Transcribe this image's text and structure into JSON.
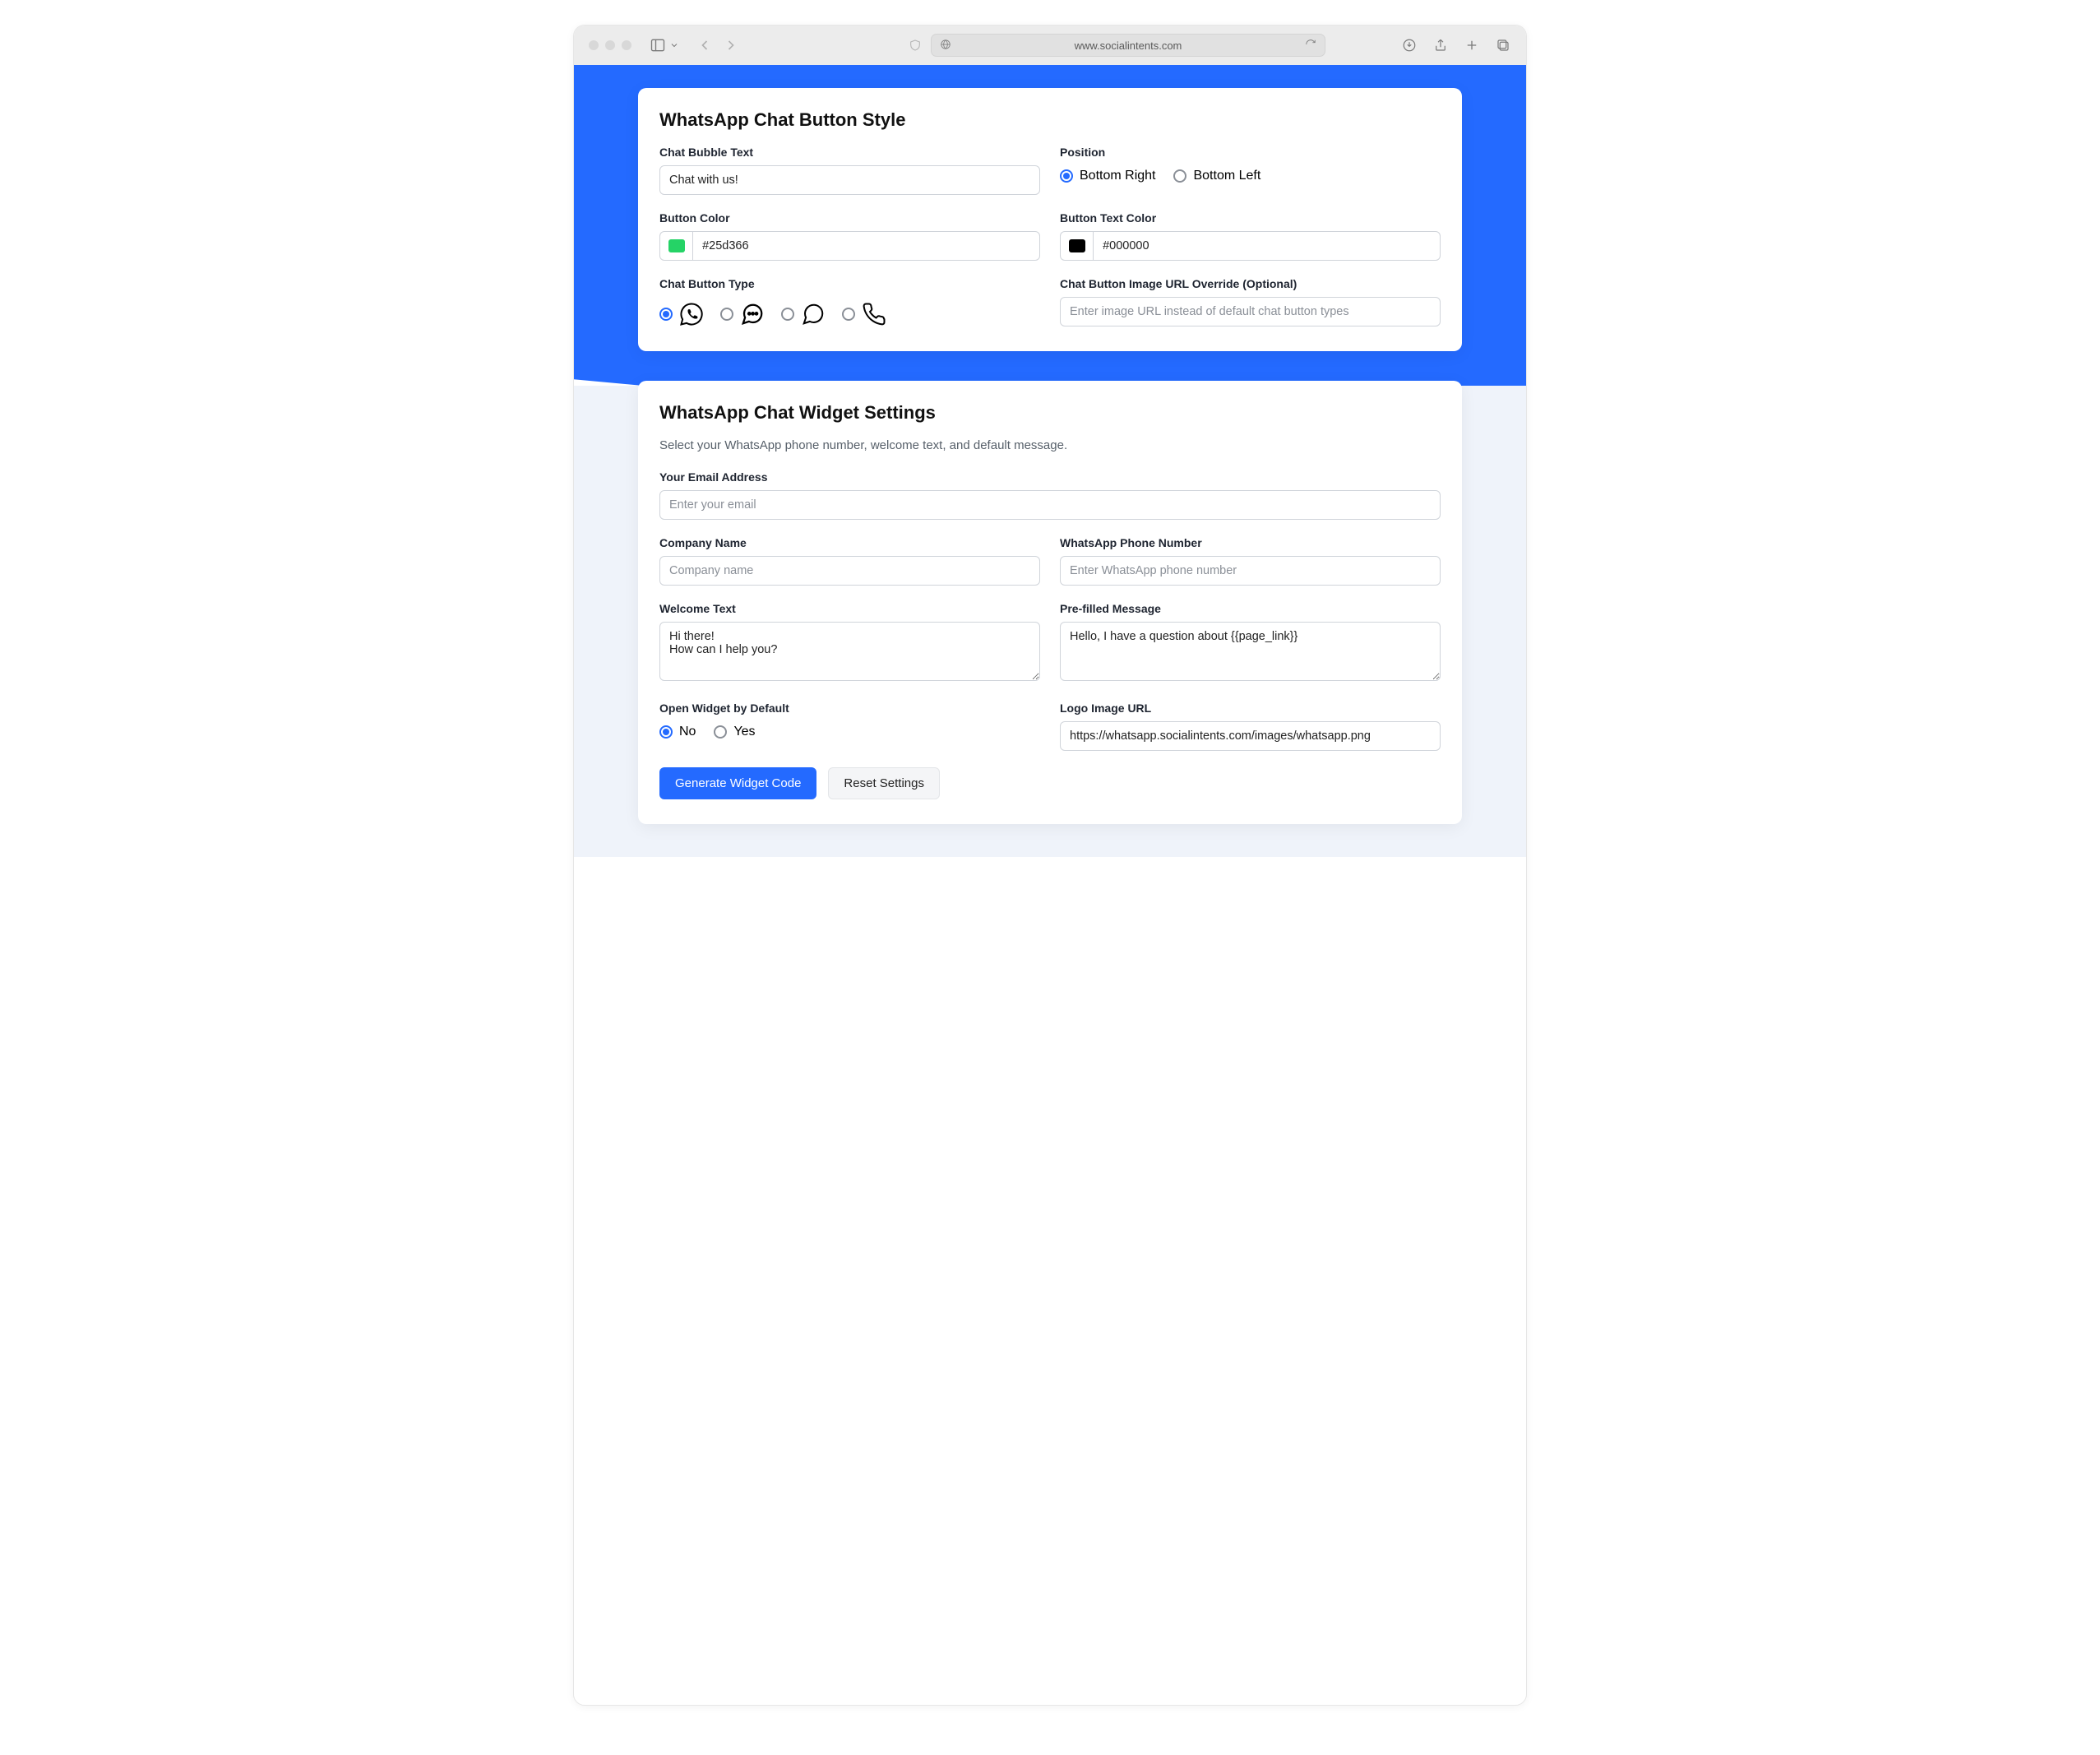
{
  "browser": {
    "url": "www.socialintents.com"
  },
  "card_style": {
    "title": "WhatsApp Chat Button Style",
    "chat_bubble": {
      "label": "Chat Bubble Text",
      "value": "Chat with us!"
    },
    "position": {
      "label": "Position",
      "options": {
        "right": "Bottom Right",
        "left": "Bottom Left"
      },
      "selected": "right"
    },
    "button_color": {
      "label": "Button Color",
      "value": "#25d366",
      "swatch": "#25d366"
    },
    "button_text_color": {
      "label": "Button Text Color",
      "value": "#000000",
      "swatch": "#000000"
    },
    "button_type": {
      "label": "Chat Button Type",
      "selected_index": 0,
      "options": [
        "whatsapp",
        "chat-bubble-dots",
        "chat-bubble",
        "phone"
      ]
    },
    "image_override": {
      "label": "Chat Button Image URL Override (Optional)",
      "placeholder": "Enter image URL instead of default chat button types",
      "value": ""
    }
  },
  "card_widget": {
    "title": "WhatsApp Chat Widget Settings",
    "subtitle": "Select your WhatsApp phone number, welcome text, and default message.",
    "email": {
      "label": "Your Email Address",
      "placeholder": "Enter your email",
      "value": ""
    },
    "company": {
      "label": "Company Name",
      "placeholder": "Company name",
      "value": ""
    },
    "phone": {
      "label": "WhatsApp Phone Number",
      "placeholder": "Enter WhatsApp phone number",
      "value": ""
    },
    "welcome": {
      "label": "Welcome Text",
      "value": "Hi there!\nHow can I help you?"
    },
    "prefilled": {
      "label": "Pre-filled Message",
      "value": "Hello, I have a question about {{page_link}}"
    },
    "open_default": {
      "label": "Open Widget by Default",
      "options": {
        "no": "No",
        "yes": "Yes"
      },
      "selected": "no"
    },
    "logo_url": {
      "label": "Logo Image URL",
      "value": "https://whatsapp.socialintents.com/images/whatsapp.png"
    },
    "actions": {
      "generate": "Generate Widget Code",
      "reset": "Reset Settings"
    }
  }
}
